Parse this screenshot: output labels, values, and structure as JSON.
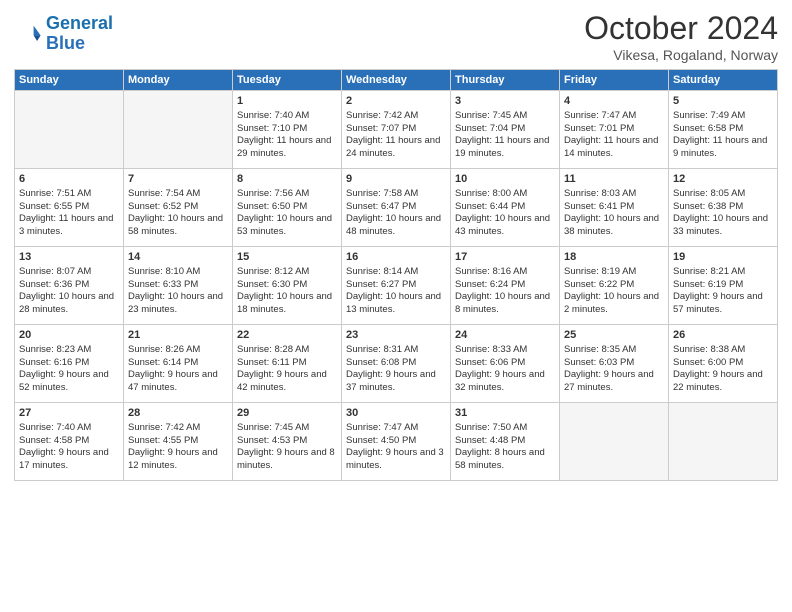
{
  "header": {
    "logo_line1": "General",
    "logo_line2": "Blue",
    "month_title": "October 2024",
    "subtitle": "Vikesa, Rogaland, Norway"
  },
  "weekdays": [
    "Sunday",
    "Monday",
    "Tuesday",
    "Wednesday",
    "Thursday",
    "Friday",
    "Saturday"
  ],
  "weeks": [
    [
      {
        "day": "",
        "empty": true
      },
      {
        "day": "",
        "empty": true
      },
      {
        "day": "1",
        "sunrise": "Sunrise: 7:40 AM",
        "sunset": "Sunset: 7:10 PM",
        "daylight": "Daylight: 11 hours and 29 minutes."
      },
      {
        "day": "2",
        "sunrise": "Sunrise: 7:42 AM",
        "sunset": "Sunset: 7:07 PM",
        "daylight": "Daylight: 11 hours and 24 minutes."
      },
      {
        "day": "3",
        "sunrise": "Sunrise: 7:45 AM",
        "sunset": "Sunset: 7:04 PM",
        "daylight": "Daylight: 11 hours and 19 minutes."
      },
      {
        "day": "4",
        "sunrise": "Sunrise: 7:47 AM",
        "sunset": "Sunset: 7:01 PM",
        "daylight": "Daylight: 11 hours and 14 minutes."
      },
      {
        "day": "5",
        "sunrise": "Sunrise: 7:49 AM",
        "sunset": "Sunset: 6:58 PM",
        "daylight": "Daylight: 11 hours and 9 minutes."
      }
    ],
    [
      {
        "day": "6",
        "sunrise": "Sunrise: 7:51 AM",
        "sunset": "Sunset: 6:55 PM",
        "daylight": "Daylight: 11 hours and 3 minutes."
      },
      {
        "day": "7",
        "sunrise": "Sunrise: 7:54 AM",
        "sunset": "Sunset: 6:52 PM",
        "daylight": "Daylight: 10 hours and 58 minutes."
      },
      {
        "day": "8",
        "sunrise": "Sunrise: 7:56 AM",
        "sunset": "Sunset: 6:50 PM",
        "daylight": "Daylight: 10 hours and 53 minutes."
      },
      {
        "day": "9",
        "sunrise": "Sunrise: 7:58 AM",
        "sunset": "Sunset: 6:47 PM",
        "daylight": "Daylight: 10 hours and 48 minutes."
      },
      {
        "day": "10",
        "sunrise": "Sunrise: 8:00 AM",
        "sunset": "Sunset: 6:44 PM",
        "daylight": "Daylight: 10 hours and 43 minutes."
      },
      {
        "day": "11",
        "sunrise": "Sunrise: 8:03 AM",
        "sunset": "Sunset: 6:41 PM",
        "daylight": "Daylight: 10 hours and 38 minutes."
      },
      {
        "day": "12",
        "sunrise": "Sunrise: 8:05 AM",
        "sunset": "Sunset: 6:38 PM",
        "daylight": "Daylight: 10 hours and 33 minutes."
      }
    ],
    [
      {
        "day": "13",
        "sunrise": "Sunrise: 8:07 AM",
        "sunset": "Sunset: 6:36 PM",
        "daylight": "Daylight: 10 hours and 28 minutes."
      },
      {
        "day": "14",
        "sunrise": "Sunrise: 8:10 AM",
        "sunset": "Sunset: 6:33 PM",
        "daylight": "Daylight: 10 hours and 23 minutes."
      },
      {
        "day": "15",
        "sunrise": "Sunrise: 8:12 AM",
        "sunset": "Sunset: 6:30 PM",
        "daylight": "Daylight: 10 hours and 18 minutes."
      },
      {
        "day": "16",
        "sunrise": "Sunrise: 8:14 AM",
        "sunset": "Sunset: 6:27 PM",
        "daylight": "Daylight: 10 hours and 13 minutes."
      },
      {
        "day": "17",
        "sunrise": "Sunrise: 8:16 AM",
        "sunset": "Sunset: 6:24 PM",
        "daylight": "Daylight: 10 hours and 8 minutes."
      },
      {
        "day": "18",
        "sunrise": "Sunrise: 8:19 AM",
        "sunset": "Sunset: 6:22 PM",
        "daylight": "Daylight: 10 hours and 2 minutes."
      },
      {
        "day": "19",
        "sunrise": "Sunrise: 8:21 AM",
        "sunset": "Sunset: 6:19 PM",
        "daylight": "Daylight: 9 hours and 57 minutes."
      }
    ],
    [
      {
        "day": "20",
        "sunrise": "Sunrise: 8:23 AM",
        "sunset": "Sunset: 6:16 PM",
        "daylight": "Daylight: 9 hours and 52 minutes."
      },
      {
        "day": "21",
        "sunrise": "Sunrise: 8:26 AM",
        "sunset": "Sunset: 6:14 PM",
        "daylight": "Daylight: 9 hours and 47 minutes."
      },
      {
        "day": "22",
        "sunrise": "Sunrise: 8:28 AM",
        "sunset": "Sunset: 6:11 PM",
        "daylight": "Daylight: 9 hours and 42 minutes."
      },
      {
        "day": "23",
        "sunrise": "Sunrise: 8:31 AM",
        "sunset": "Sunset: 6:08 PM",
        "daylight": "Daylight: 9 hours and 37 minutes."
      },
      {
        "day": "24",
        "sunrise": "Sunrise: 8:33 AM",
        "sunset": "Sunset: 6:06 PM",
        "daylight": "Daylight: 9 hours and 32 minutes."
      },
      {
        "day": "25",
        "sunrise": "Sunrise: 8:35 AM",
        "sunset": "Sunset: 6:03 PM",
        "daylight": "Daylight: 9 hours and 27 minutes."
      },
      {
        "day": "26",
        "sunrise": "Sunrise: 8:38 AM",
        "sunset": "Sunset: 6:00 PM",
        "daylight": "Daylight: 9 hours and 22 minutes."
      }
    ],
    [
      {
        "day": "27",
        "sunrise": "Sunrise: 7:40 AM",
        "sunset": "Sunset: 4:58 PM",
        "daylight": "Daylight: 9 hours and 17 minutes."
      },
      {
        "day": "28",
        "sunrise": "Sunrise: 7:42 AM",
        "sunset": "Sunset: 4:55 PM",
        "daylight": "Daylight: 9 hours and 12 minutes."
      },
      {
        "day": "29",
        "sunrise": "Sunrise: 7:45 AM",
        "sunset": "Sunset: 4:53 PM",
        "daylight": "Daylight: 9 hours and 8 minutes."
      },
      {
        "day": "30",
        "sunrise": "Sunrise: 7:47 AM",
        "sunset": "Sunset: 4:50 PM",
        "daylight": "Daylight: 9 hours and 3 minutes."
      },
      {
        "day": "31",
        "sunrise": "Sunrise: 7:50 AM",
        "sunset": "Sunset: 4:48 PM",
        "daylight": "Daylight: 8 hours and 58 minutes."
      },
      {
        "day": "",
        "empty": true
      },
      {
        "day": "",
        "empty": true
      }
    ]
  ]
}
